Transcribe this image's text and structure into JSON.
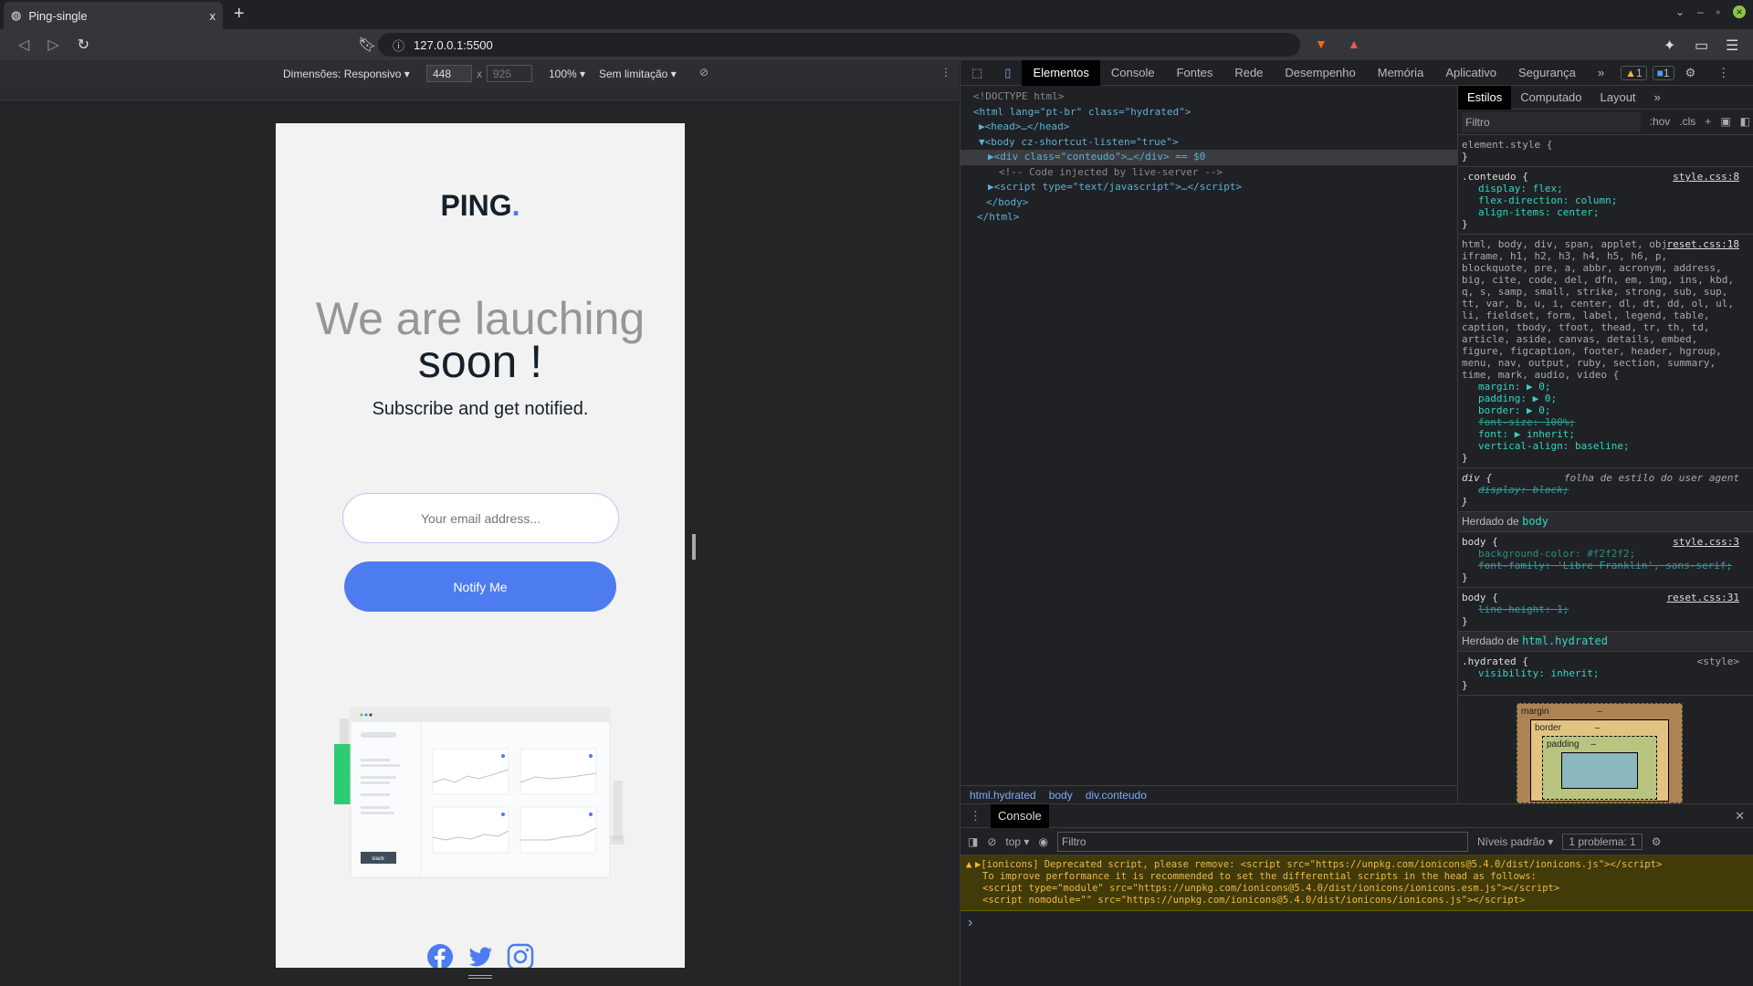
{
  "browser": {
    "tab_title": "Ping-single",
    "new_tab": "+",
    "url": "127.0.0.1:5500",
    "close_tab": "x"
  },
  "device_toolbar": {
    "dimensions": "Dimensões: Responsivo ▾",
    "width": "448",
    "x": "x",
    "height": "925",
    "zoom": "100% ▾",
    "throttle": "Sem limitação ▾"
  },
  "page": {
    "logo": "PING",
    "logo_dot": ".",
    "heading_light": "We are lauching",
    "heading_bold": "soon !",
    "subtitle": "Subscribe and get notified.",
    "email_placeholder": "Your email address...",
    "button": "Notify Me",
    "illustration_brand": "slack",
    "accent": "#4d7cf0",
    "background": "#f2f2f2"
  },
  "devtools": {
    "tabs": [
      "Elementos",
      "Console",
      "Fontes",
      "Rede",
      "Desempenho",
      "Memória",
      "Aplicativo",
      "Segurança"
    ],
    "more": "»",
    "warnings": "1",
    "messages": "1",
    "dom_lines": [
      "<!DOCTYPE html>",
      "<html lang=\"pt-br\" class=\"hydrated\">",
      "▶<head>…</head>",
      "▼<body cz-shortcut-listen=\"true\">",
      "▶<div class=\"conteudo\">…</div> == $0",
      "<!-- Code injected by live-server -->",
      "▶<script type=\"text/javascript\">…</script>",
      "</body>",
      "</html>"
    ],
    "breadcrumbs": [
      "html.hydrated",
      "body",
      "div.conteudo"
    ],
    "styles_tabs": [
      "Estilos",
      "Computado",
      "Layout",
      "»"
    ],
    "styles_filter": "Filtro",
    "hov": ":hov",
    "cls": ".cls",
    "rules": {
      "element_style": "element.style {",
      "conteudo_sel": ".conteudo {",
      "conteudo_src": "style.css:8",
      "conteudo_props": [
        "display: flex;",
        "flex-direction: column;",
        "align-items: center;"
      ],
      "reset_sel": "html, body, div, span, applet, object, iframe, h1, h2, h3, h4, h5, h6, p, blockquote, pre, a, abbr, acronym, address, big, cite, code, del, dfn, em, img, ins, kbd, q, s, samp, small, strike, strong, sub, sup, tt, var, b, u, i, center, dl, dt, dd, ol, ul, li, fieldset, form, label, legend, table, caption, tbody, tfoot, thead, tr, th, td, article, aside, canvas, details, embed, figure, figcaption, footer, header, hgroup, menu, nav, output, ruby, section, summary, time, mark, audio, video {",
      "reset_src": "reset.css:18",
      "reset_props": [
        "margin: ▶ 0;",
        "padding: ▶ 0;",
        "border: ▶ 0;",
        "font-size: 100%;",
        "font: ▶ inherit;",
        "vertical-align: baseline;"
      ],
      "div_sel": "div {",
      "div_src": "folha de estilo do user agent",
      "div_prop": "display: block;",
      "inherited_body": "Herdado de",
      "inherited_body_el": "body",
      "body1_src": "style.css:3",
      "body1_props": [
        "background-color: #f2f2f2;",
        "font-family: 'Libre Franklin', sans-serif;"
      ],
      "body2_src": "reset.css:31",
      "body2_prop": "line-height: 1;",
      "body_sel": "body {",
      "inherited_html_el": "html.hydrated",
      "hydrated_sel": ".hydrated {",
      "hydrated_src": "<style>",
      "hydrated_prop": "visibility: inherit;",
      "close": "}"
    },
    "box_model": {
      "margin": "margin",
      "border": "border",
      "padding": "padding",
      "dash": "–"
    },
    "console": {
      "title": "Console",
      "context": "top ▾",
      "filter": "Filtro",
      "levels": "Níveis padrão ▾",
      "problems": "1 problema: 1",
      "warning_lines": [
        "▶[ionicons] Deprecated script, please remove: <script src=\"https://unpkg.com/ionicons@5.4.0/dist/ionicons.js\"></script>",
        "To improve performance it is recommended to set the differential scripts in the head as follows:",
        "<script type=\"module\" src=\"https://unpkg.com/ionicons@5.4.0/dist/ionicons/ionicons.esm.js\"></script>",
        "<script nomodule=\"\" src=\"https://unpkg.com/ionicons@5.4.0/dist/ionicons/ionicons.js\"></script>"
      ],
      "prompt": "›"
    }
  }
}
